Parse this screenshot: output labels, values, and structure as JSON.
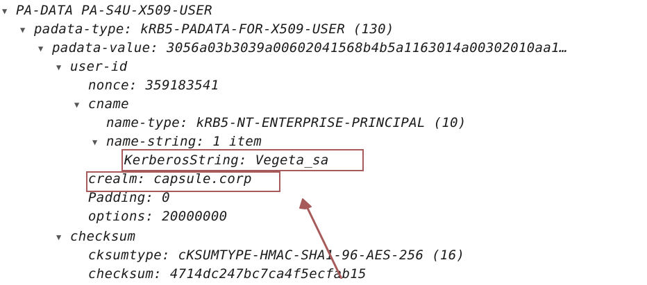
{
  "tree": [
    {
      "depth": 0,
      "expanded": true,
      "text": "PA-DATA PA-S4U-X509-USER"
    },
    {
      "depth": 1,
      "expanded": true,
      "text": "padata-type: kRB5-PADATA-FOR-X509-USER (130)"
    },
    {
      "depth": 2,
      "expanded": true,
      "text": "padata-value: 3056a03b3039a00602041568b4b5a1163014a00302010aa1…"
    },
    {
      "depth": 3,
      "expanded": true,
      "text": "user-id"
    },
    {
      "depth": 4,
      "expanded": false,
      "text": "nonce: 359183541"
    },
    {
      "depth": 4,
      "expanded": true,
      "text": "cname"
    },
    {
      "depth": 5,
      "expanded": false,
      "text": "name-type: kRB5-NT-ENTERPRISE-PRINCIPAL (10)"
    },
    {
      "depth": 5,
      "expanded": true,
      "text": "name-string: 1 item"
    },
    {
      "depth": 6,
      "expanded": false,
      "text": "KerberosString: Vegeta_sa",
      "highlighted": true
    },
    {
      "depth": 4,
      "expanded": false,
      "text": "crealm: capsule.corp",
      "highlighted": true
    },
    {
      "depth": 4,
      "expanded": false,
      "text": "Padding: 0"
    },
    {
      "depth": 4,
      "expanded": false,
      "text": "options: 20000000"
    },
    {
      "depth": 3,
      "expanded": true,
      "text": "checksum"
    },
    {
      "depth": 4,
      "expanded": false,
      "text": "cksumtype: cKSUMTYPE-HMAC-SHA1-96-AES-256 (16)"
    },
    {
      "depth": 4,
      "expanded": false,
      "text": "checksum: 4714dc247bc7ca4f5ecfab15"
    }
  ],
  "colors": {
    "highlight_box": "#a65a5a",
    "arrow": "#a65a5a",
    "text": "#1a1a1a"
  },
  "icons": {
    "expand": "triangle-down-icon"
  }
}
